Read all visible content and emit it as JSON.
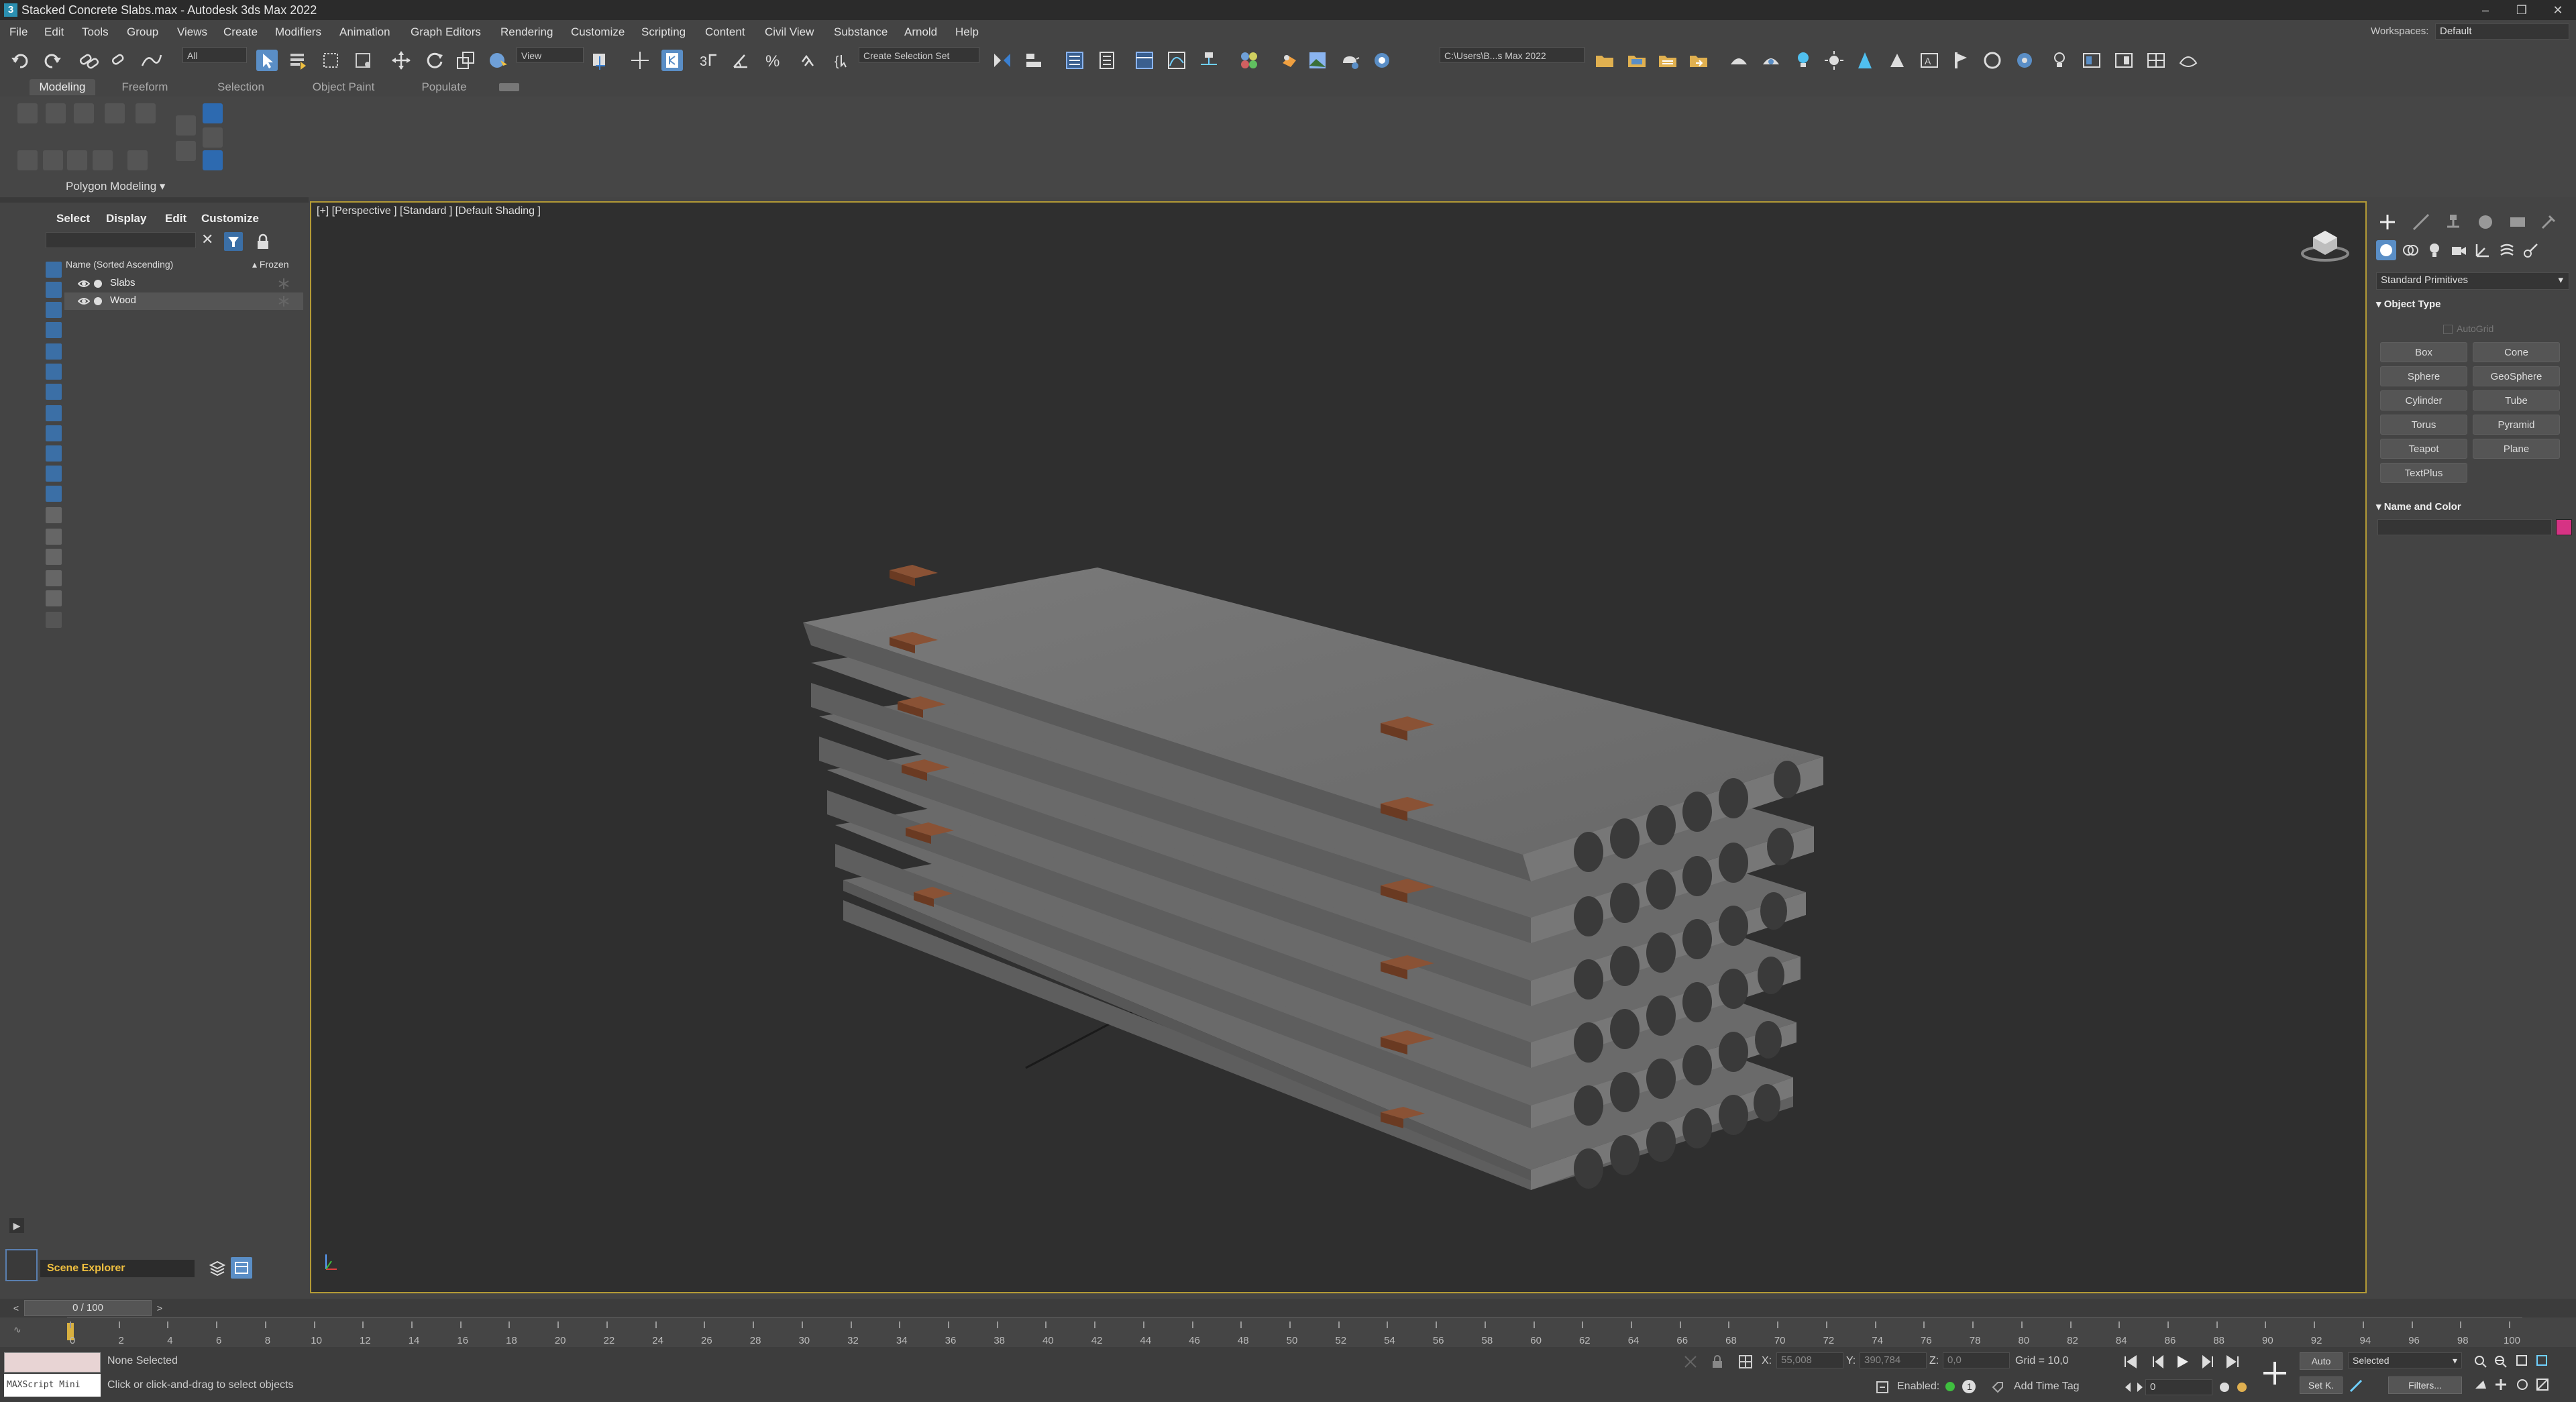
{
  "window": {
    "title": "Stacked Concrete Slabs.max - Autodesk 3ds Max 2022",
    "app_icon": "3",
    "workspaces_label": "Workspaces:",
    "workspaces_value": "Default"
  },
  "menu": [
    "File",
    "Edit",
    "Tools",
    "Group",
    "Views",
    "Create",
    "Modifiers",
    "Animation",
    "Graph Editors",
    "Rendering",
    "Customize",
    "Scripting",
    "Content",
    "Civil View",
    "Substance",
    "Arnold",
    "Help"
  ],
  "toolbar": {
    "filter_value": "All",
    "reference_coord": "View",
    "selection_set": "Create Selection Set",
    "project_path": "C:\\Users\\B...s Max 2022"
  },
  "ribbon": {
    "tabs": [
      "Modeling",
      "Freeform",
      "Selection",
      "Object Paint",
      "Populate"
    ],
    "active_tab": "Modeling",
    "panel_label": "Polygon Modeling"
  },
  "explorer": {
    "tabs": [
      "Select",
      "Display",
      "Edit",
      "Customize"
    ],
    "column_name": "Name (Sorted Ascending)",
    "column_frozen": "▴ Frozen",
    "items": [
      {
        "label": "Slabs"
      },
      {
        "label": "Wood"
      }
    ],
    "footer_title": "Scene Explorer"
  },
  "viewport": {
    "label": "[+] [Perspective ] [Standard ] [Default Shading ]"
  },
  "command_panel": {
    "category": "Standard Primitives",
    "object_type_title": "Object Type",
    "autogrid": "AutoGrid",
    "buttons": [
      "Box",
      "Cone",
      "Sphere",
      "GeoSphere",
      "Cylinder",
      "Tube",
      "Torus",
      "Pyramid",
      "Teapot",
      "Plane",
      "TextPlus"
    ],
    "name_color_title": "Name and Color",
    "object_color": "#d63384"
  },
  "timeline": {
    "frame_counter": "0 / 100",
    "ticks": [
      "0",
      "2",
      "4",
      "6",
      "8",
      "10",
      "12",
      "14",
      "16",
      "18",
      "20",
      "22",
      "24",
      "26",
      "28",
      "30",
      "32",
      "34",
      "36",
      "38",
      "40",
      "42",
      "44",
      "46",
      "48",
      "50",
      "52",
      "54",
      "56",
      "58",
      "60",
      "62",
      "64",
      "66",
      "68",
      "70",
      "72",
      "74",
      "76",
      "78",
      "80",
      "82",
      "84",
      "86",
      "88",
      "90",
      "92",
      "94",
      "96",
      "98",
      "100"
    ]
  },
  "status": {
    "maxscript": "MAXScript Mini",
    "selection": "None Selected",
    "prompt": "Click or click-and-drag to select objects",
    "x_label": "X:",
    "x_value": "55,008",
    "y_label": "Y:",
    "y_value": "390,784",
    "z_label": "Z:",
    "z_value": "0,0",
    "grid": "Grid = 10,0",
    "enabled_label": "Enabled:",
    "add_time_tag": "Add Time Tag",
    "auto_key": "Auto",
    "set_key": "Set K.",
    "key_filter": "Selected",
    "filters": "Filters...",
    "current_frame": "0"
  }
}
